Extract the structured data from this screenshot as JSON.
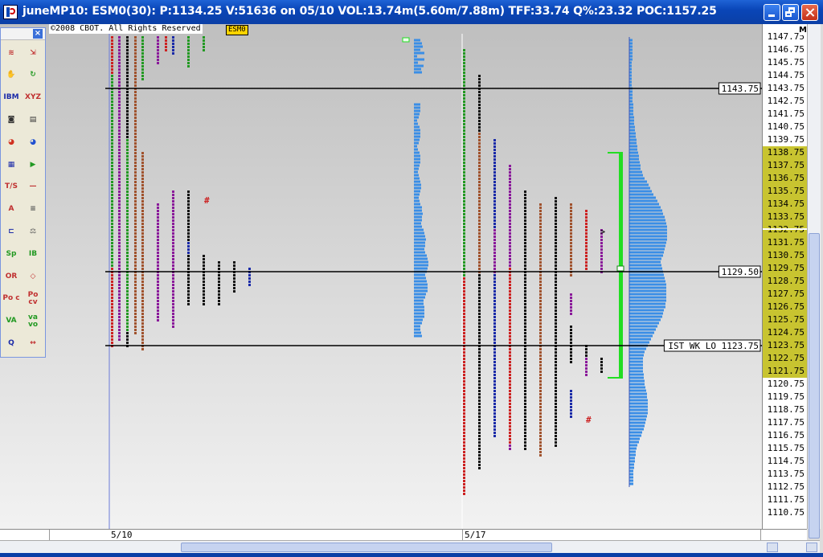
{
  "window": {
    "title": "juneMP10: ESM0(30): P:1134.25 V:51636 on 05/10 VOL:13.74m(5.60m/7.88m)  TFF:33.74 Q%:23.32 POC:1157.25"
  },
  "chart": {
    "copyright": "©2008 CBOT. All Rights Reserved",
    "symbol": "ESM0",
    "axis_badge": "M",
    "price_axis": [
      "1147.75",
      "1146.75",
      "1145.75",
      "1144.75",
      "1143.75",
      "1142.75",
      "1141.75",
      "1140.75",
      "1139.75",
      "1138.75",
      "1137.75",
      "1136.75",
      "1135.75",
      "1134.75",
      "1133.75",
      "1132.75",
      "1131.75",
      "1130.75",
      "1129.75",
      "1128.75",
      "1127.75",
      "1126.75",
      "1125.75",
      "1124.75",
      "1123.75",
      "1122.75",
      "1121.75",
      "1120.75",
      "1119.75",
      "1118.75",
      "1117.75",
      "1116.75",
      "1115.75",
      "1114.75",
      "1113.75",
      "1112.75",
      "1111.75",
      "1110.75"
    ],
    "highlight_range": [
      "1138.75",
      "1121.75"
    ],
    "date_axis": [
      "5/10",
      "5/17"
    ],
    "reference_lines": [
      {
        "price": 1143.75,
        "label": "1143.75"
      },
      {
        "price": 1129.5,
        "label": "1129.50"
      },
      {
        "price": 1123.75,
        "label": "IST WK LO 1123.75"
      }
    ],
    "colors": {
      "background_top": "#bfbfbf",
      "background_bottom": "#f2f2f2",
      "volume_bar": "#3a8ee6",
      "value_area": "#22dd22",
      "highlight": "#c8c430",
      "red": "#cc2222",
      "green": "#229922",
      "purple": "#8a1a9a",
      "blue": "#1a2aa8",
      "brown": "#a0522d",
      "black": "#111111"
    }
  },
  "toolbox": {
    "close_label": "×",
    "tools": [
      {
        "name": "bars-tool-icon",
        "label": "≋",
        "color": "#c03030"
      },
      {
        "name": "arrow-tool-icon",
        "label": "⇲",
        "color": "#c03030"
      },
      {
        "name": "hand-tool-icon",
        "label": "✋",
        "color": "#333333"
      },
      {
        "name": "refresh-tool-icon",
        "label": "↻",
        "color": "#229922"
      },
      {
        "name": "ibm-symbol-icon",
        "label": "IBM",
        "color": "#1a2aa8"
      },
      {
        "name": "xyz-symbol-icon",
        "label": "XYZ",
        "color": "#c03030"
      },
      {
        "name": "camera-icon",
        "label": "◙",
        "color": "#333333"
      },
      {
        "name": "document-icon",
        "label": "▤",
        "color": "#333333"
      },
      {
        "name": "color-wheel-icon",
        "label": "◕",
        "color": "#d03020"
      },
      {
        "name": "color-picker-icon",
        "label": "◕",
        "color": "#2050d0"
      },
      {
        "name": "grid-icon",
        "label": "▦",
        "color": "#1a2aa8"
      },
      {
        "name": "play-icon",
        "label": "▶",
        "color": "#229922"
      },
      {
        "name": "time-split-icon",
        "label": "T/S",
        "color": "#c03030"
      },
      {
        "name": "line-tool-icon",
        "label": "—",
        "color": "#c03030"
      },
      {
        "name": "text-tool-icon",
        "label": "A",
        "color": "#c03030"
      },
      {
        "name": "align-tool-icon",
        "label": "≡",
        "color": "#555555"
      },
      {
        "name": "profile-tool-icon",
        "label": "⊏",
        "color": "#1a2aa8"
      },
      {
        "name": "balance-icon",
        "label": "⚖",
        "color": "#555555"
      },
      {
        "name": "split-profile-icon",
        "label": "Sp",
        "color": "#229922"
      },
      {
        "name": "initial-balance-icon",
        "label": "IB",
        "color": "#229922"
      },
      {
        "name": "opening-range-icon",
        "label": "OR",
        "color": "#c03030"
      },
      {
        "name": "diamond-icon",
        "label": "◇",
        "color": "#c03030"
      },
      {
        "name": "poc-icon",
        "label": "Po c",
        "color": "#c03030"
      },
      {
        "name": "poc-cv-icon",
        "label": "Po cv",
        "color": "#c03030"
      },
      {
        "name": "value-area-icon",
        "label": "VA",
        "color": "#229922"
      },
      {
        "name": "value-area-volume-icon",
        "label": "va vo",
        "color": "#229922"
      },
      {
        "name": "zoom-icon",
        "label": "Q",
        "color": "#1a2aa8"
      },
      {
        "name": "expand-icon",
        "label": "↔",
        "color": "#c03030"
      }
    ]
  }
}
